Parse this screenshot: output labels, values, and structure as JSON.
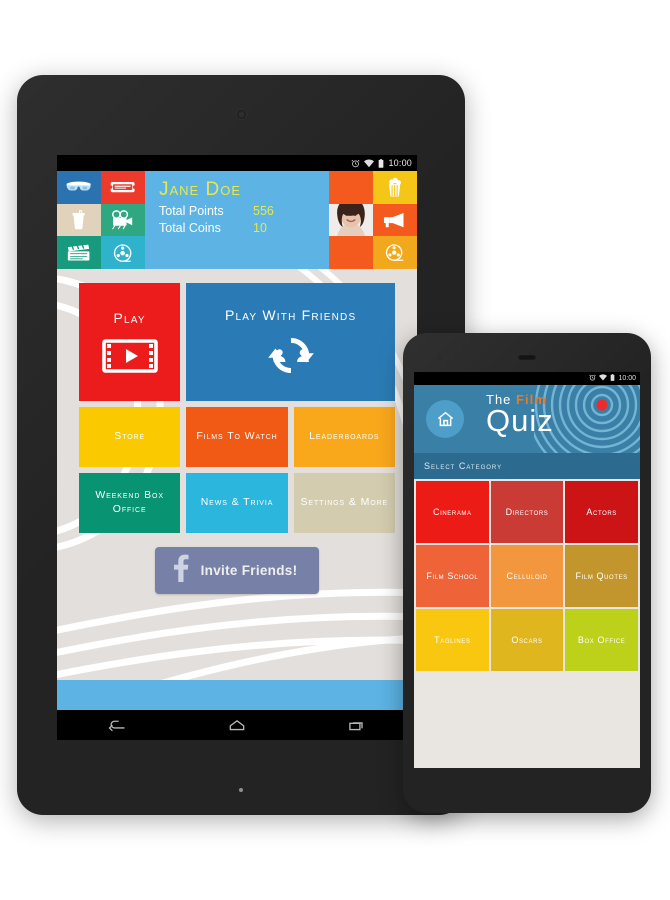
{
  "scene": {
    "devices": [
      "tablet",
      "phone"
    ]
  },
  "tablet": {
    "statusbar": {
      "time": "10:00",
      "icons": [
        "alarm-icon",
        "wifi-icon",
        "battery-icon"
      ]
    },
    "profile": {
      "name": "Jane Doe",
      "stats": [
        {
          "label": "Total Points",
          "value": "556"
        },
        {
          "label": "Total Coins",
          "value": "10"
        }
      ],
      "name_color": "#e8e84a",
      "value_color": "#e8e84a",
      "header_bg": "#5cb3e4",
      "left_icons": [
        {
          "name": "3d-glasses-icon",
          "bg": "#2b72b0"
        },
        {
          "name": "ticket-icon",
          "bg": "#ee3a2b"
        },
        {
          "name": "drink-cup-icon",
          "bg": "#e0d2bb"
        },
        {
          "name": "movie-camera-icon",
          "bg": "#2fa882"
        },
        {
          "name": "clapperboard-icon",
          "bg": "#179a7d"
        },
        {
          "name": "film-reel-icon",
          "bg": "#2fb3cd"
        }
      ],
      "right_icons": [
        {
          "name": "orange-block",
          "bg": "#f4591d"
        },
        {
          "name": "popcorn-icon",
          "bg": "#f5c518"
        },
        {
          "name": "avatar",
          "bg": "#c98a6d"
        },
        {
          "name": "megaphone-icon",
          "bg": "#f4591d"
        },
        {
          "name": "orange-block-2",
          "bg": "#f4591d"
        },
        {
          "name": "film-reel-icon-2",
          "bg": "#f2a81d"
        }
      ]
    },
    "tiles": [
      {
        "label": "Play",
        "bg": "#ed1c1c",
        "icon": "film-play-icon",
        "size": "big"
      },
      {
        "label": "Play with Friends",
        "bg": "#2a7bb5",
        "icon": "sync-friends-icon",
        "size": "big"
      },
      {
        "label": "Store",
        "bg": "#fac900",
        "icon": "",
        "size": "small"
      },
      {
        "label": "Films to Watch",
        "bg": "#f05a15",
        "icon": "",
        "size": "small"
      },
      {
        "label": "Leaderboards",
        "bg": "#f9a71b",
        "icon": "",
        "size": "small"
      },
      {
        "label": "Weekend Box Office",
        "bg": "#089372",
        "icon": "",
        "size": "small"
      },
      {
        "label": "News & Trivia",
        "bg": "#2bb6dd",
        "icon": "",
        "size": "small"
      },
      {
        "label": "Settings & More",
        "bg": "#d4ccae",
        "icon": "",
        "size": "small"
      }
    ],
    "invite": {
      "label": "Invite Friends!",
      "icon": "facebook-icon",
      "bg": "#7781a8"
    },
    "navbar": {
      "items": [
        {
          "name": "back-icon"
        },
        {
          "name": "home-icon"
        },
        {
          "name": "recents-icon"
        }
      ]
    },
    "background_color": "#e3dfdc"
  },
  "phone": {
    "statusbar": {
      "time": "10:00",
      "icons": [
        "alarm-icon",
        "wifi-icon",
        "battery-icon"
      ]
    },
    "header": {
      "home_icon": "home-icon",
      "logo_the": "The",
      "logo_film": "Film",
      "logo_quiz": "Quiz",
      "bg": "#3a7fa6",
      "ring_color": "#74b4d4",
      "dot_color": "#ee2b2b"
    },
    "select_bar": {
      "label": "Select Category",
      "bg": "#2c6b8f"
    },
    "categories": [
      {
        "label": "Cinerama",
        "bg": "#ec1b16"
      },
      {
        "label": "Directors",
        "bg": "#ca3b35"
      },
      {
        "label": "Actors",
        "bg": "#cc1417"
      },
      {
        "label": "Film School",
        "bg": "#ef6339"
      },
      {
        "label": "Celluloid",
        "bg": "#f2973d"
      },
      {
        "label": "Film Quotes",
        "bg": "#c2962c"
      },
      {
        "label": "Taglines",
        "bg": "#fac710"
      },
      {
        "label": "Oscars",
        "bg": "#dfb61d"
      },
      {
        "label": "Box Office",
        "bg": "#bed11a"
      }
    ],
    "background_color": "#e9e5e1"
  }
}
